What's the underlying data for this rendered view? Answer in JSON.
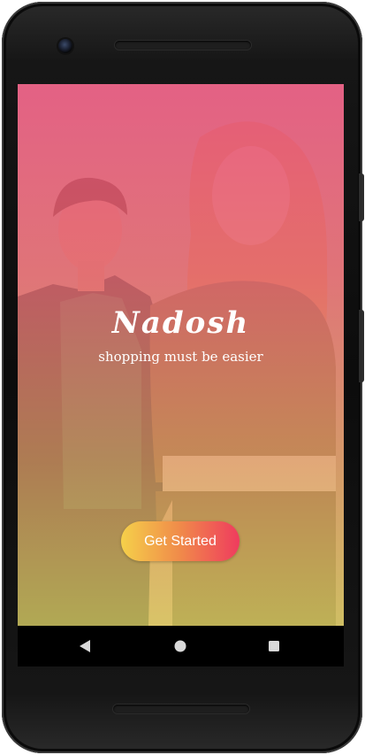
{
  "app": {
    "brand": "Nadosh",
    "tagline": "shopping must be easier",
    "cta_label": "Get Started"
  },
  "colors": {
    "overlay_top": "#e8527e",
    "overlay_bottom": "#d6c85a",
    "button_start": "#f5d04a",
    "button_end": "#ef3b5e"
  },
  "navbar": {
    "back_icon": "back-triangle-icon",
    "home_icon": "home-circle-icon",
    "recents_icon": "recents-square-icon"
  }
}
